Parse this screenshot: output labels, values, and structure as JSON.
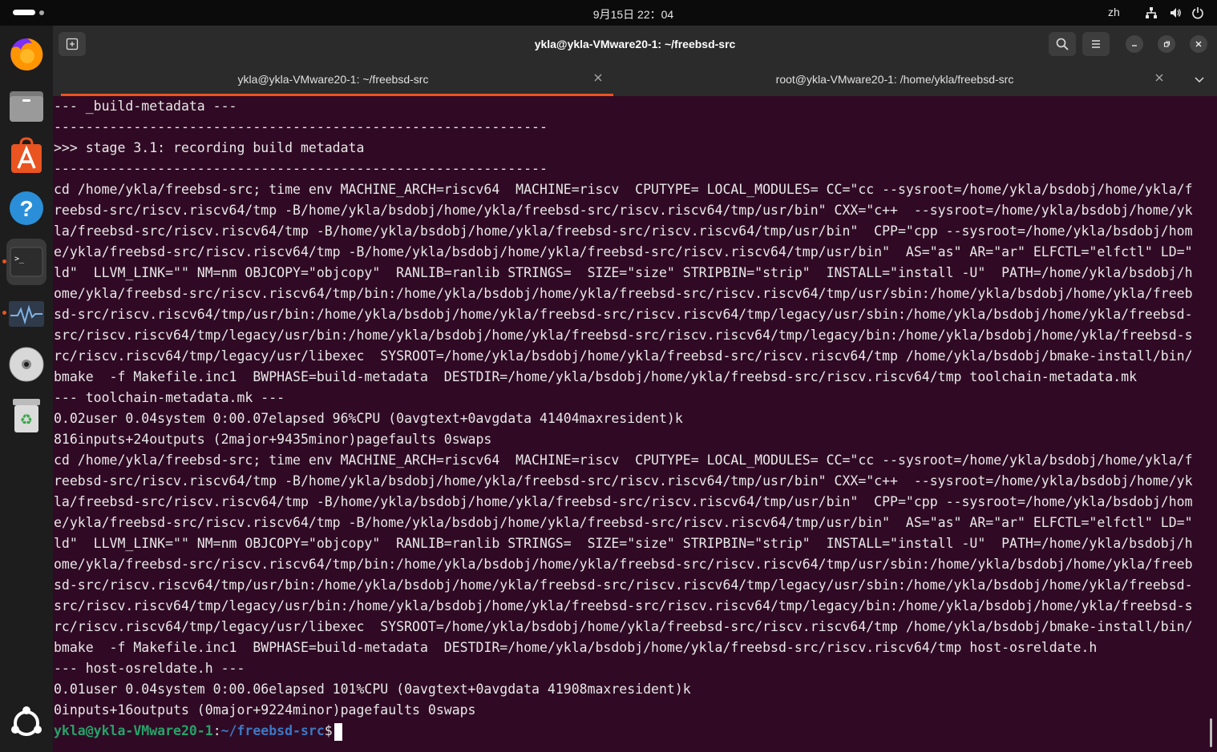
{
  "topbar": {
    "clock": "9月15日 22：04",
    "input_method": "zh"
  },
  "window": {
    "title": "ykla@ykla-VMware20-1: ~/freebsd-src",
    "tabs": [
      {
        "label": "ykla@ykla-VMware20-1: ~/freebsd-src"
      },
      {
        "label": "root@ykla-VMware20-1: /home/ykla/freebsd-src"
      }
    ]
  },
  "dock": {
    "items": [
      "firefox-icon",
      "files-icon",
      "app-center-icon",
      "help-icon",
      "terminal-icon",
      "system-monitor-icon",
      "disc-icon",
      "trash-icon",
      "ubuntu-icon"
    ]
  },
  "terminal": {
    "lines": [
      "--- _build-metadata ---",
      "--------------------------------------------------------------",
      ">>> stage 3.1: recording build metadata",
      "--------------------------------------------------------------",
      "cd /home/ykla/freebsd-src; time env MACHINE_ARCH=riscv64  MACHINE=riscv  CPUTYPE= LOCAL_MODULES= CC=\"cc --sysroot=/home/ykla/bsdobj/home/ykla/f",
      "reebsd-src/riscv.riscv64/tmp -B/home/ykla/bsdobj/home/ykla/freebsd-src/riscv.riscv64/tmp/usr/bin\" CXX=\"c++  --sysroot=/home/ykla/bsdobj/home/yk",
      "la/freebsd-src/riscv.riscv64/tmp -B/home/ykla/bsdobj/home/ykla/freebsd-src/riscv.riscv64/tmp/usr/bin\"  CPP=\"cpp --sysroot=/home/ykla/bsdobj/hom",
      "e/ykla/freebsd-src/riscv.riscv64/tmp -B/home/ykla/bsdobj/home/ykla/freebsd-src/riscv.riscv64/tmp/usr/bin\"  AS=\"as\" AR=\"ar\" ELFCTL=\"elfctl\" LD=\"",
      "ld\"  LLVM_LINK=\"\" NM=nm OBJCOPY=\"objcopy\"  RANLIB=ranlib STRINGS=  SIZE=\"size\" STRIPBIN=\"strip\"  INSTALL=\"install -U\"  PATH=/home/ykla/bsdobj/h",
      "ome/ykla/freebsd-src/riscv.riscv64/tmp/bin:/home/ykla/bsdobj/home/ykla/freebsd-src/riscv.riscv64/tmp/usr/sbin:/home/ykla/bsdobj/home/ykla/freeb",
      "sd-src/riscv.riscv64/tmp/usr/bin:/home/ykla/bsdobj/home/ykla/freebsd-src/riscv.riscv64/tmp/legacy/usr/sbin:/home/ykla/bsdobj/home/ykla/freebsd-",
      "src/riscv.riscv64/tmp/legacy/usr/bin:/home/ykla/bsdobj/home/ykla/freebsd-src/riscv.riscv64/tmp/legacy/bin:/home/ykla/bsdobj/home/ykla/freebsd-s",
      "rc/riscv.riscv64/tmp/legacy/usr/libexec  SYSROOT=/home/ykla/bsdobj/home/ykla/freebsd-src/riscv.riscv64/tmp /home/ykla/bsdobj/bmake-install/bin/",
      "bmake  -f Makefile.inc1  BWPHASE=build-metadata  DESTDIR=/home/ykla/bsdobj/home/ykla/freebsd-src/riscv.riscv64/tmp toolchain-metadata.mk",
      "--- toolchain-metadata.mk ---",
      "0.02user 0.04system 0:00.07elapsed 96%CPU (0avgtext+0avgdata 41404maxresident)k",
      "816inputs+24outputs (2major+9435minor)pagefaults 0swaps",
      "cd /home/ykla/freebsd-src; time env MACHINE_ARCH=riscv64  MACHINE=riscv  CPUTYPE= LOCAL_MODULES= CC=\"cc --sysroot=/home/ykla/bsdobj/home/ykla/f",
      "reebsd-src/riscv.riscv64/tmp -B/home/ykla/bsdobj/home/ykla/freebsd-src/riscv.riscv64/tmp/usr/bin\" CXX=\"c++  --sysroot=/home/ykla/bsdobj/home/yk",
      "la/freebsd-src/riscv.riscv64/tmp -B/home/ykla/bsdobj/home/ykla/freebsd-src/riscv.riscv64/tmp/usr/bin\"  CPP=\"cpp --sysroot=/home/ykla/bsdobj/hom",
      "e/ykla/freebsd-src/riscv.riscv64/tmp -B/home/ykla/bsdobj/home/ykla/freebsd-src/riscv.riscv64/tmp/usr/bin\"  AS=\"as\" AR=\"ar\" ELFCTL=\"elfctl\" LD=\"",
      "ld\"  LLVM_LINK=\"\" NM=nm OBJCOPY=\"objcopy\"  RANLIB=ranlib STRINGS=  SIZE=\"size\" STRIPBIN=\"strip\"  INSTALL=\"install -U\"  PATH=/home/ykla/bsdobj/h",
      "ome/ykla/freebsd-src/riscv.riscv64/tmp/bin:/home/ykla/bsdobj/home/ykla/freebsd-src/riscv.riscv64/tmp/usr/sbin:/home/ykla/bsdobj/home/ykla/freeb",
      "sd-src/riscv.riscv64/tmp/usr/bin:/home/ykla/bsdobj/home/ykla/freebsd-src/riscv.riscv64/tmp/legacy/usr/sbin:/home/ykla/bsdobj/home/ykla/freebsd-",
      "src/riscv.riscv64/tmp/legacy/usr/bin:/home/ykla/bsdobj/home/ykla/freebsd-src/riscv.riscv64/tmp/legacy/bin:/home/ykla/bsdobj/home/ykla/freebsd-s",
      "rc/riscv.riscv64/tmp/legacy/usr/libexec  SYSROOT=/home/ykla/bsdobj/home/ykla/freebsd-src/riscv.riscv64/tmp /home/ykla/bsdobj/bmake-install/bin/",
      "bmake  -f Makefile.inc1  BWPHASE=build-metadata  DESTDIR=/home/ykla/bsdobj/home/ykla/freebsd-src/riscv.riscv64/tmp host-osreldate.h",
      "--- host-osreldate.h ---",
      "0.01user 0.04system 0:00.06elapsed 101%CPU (0avgtext+0avgdata 41908maxresident)k",
      "0inputs+16outputs (0major+9224minor)pagefaults 0swaps"
    ],
    "prompt": {
      "user_host": "ykla@ykla-VMware20-1",
      "separator": ":",
      "path": "~/freebsd-src",
      "symbol": "$"
    }
  },
  "colors": {
    "terminal_bg": "#300a24",
    "accent": "#e95420",
    "prompt_user": "#26a269",
    "prompt_path": "#3b78c4"
  }
}
